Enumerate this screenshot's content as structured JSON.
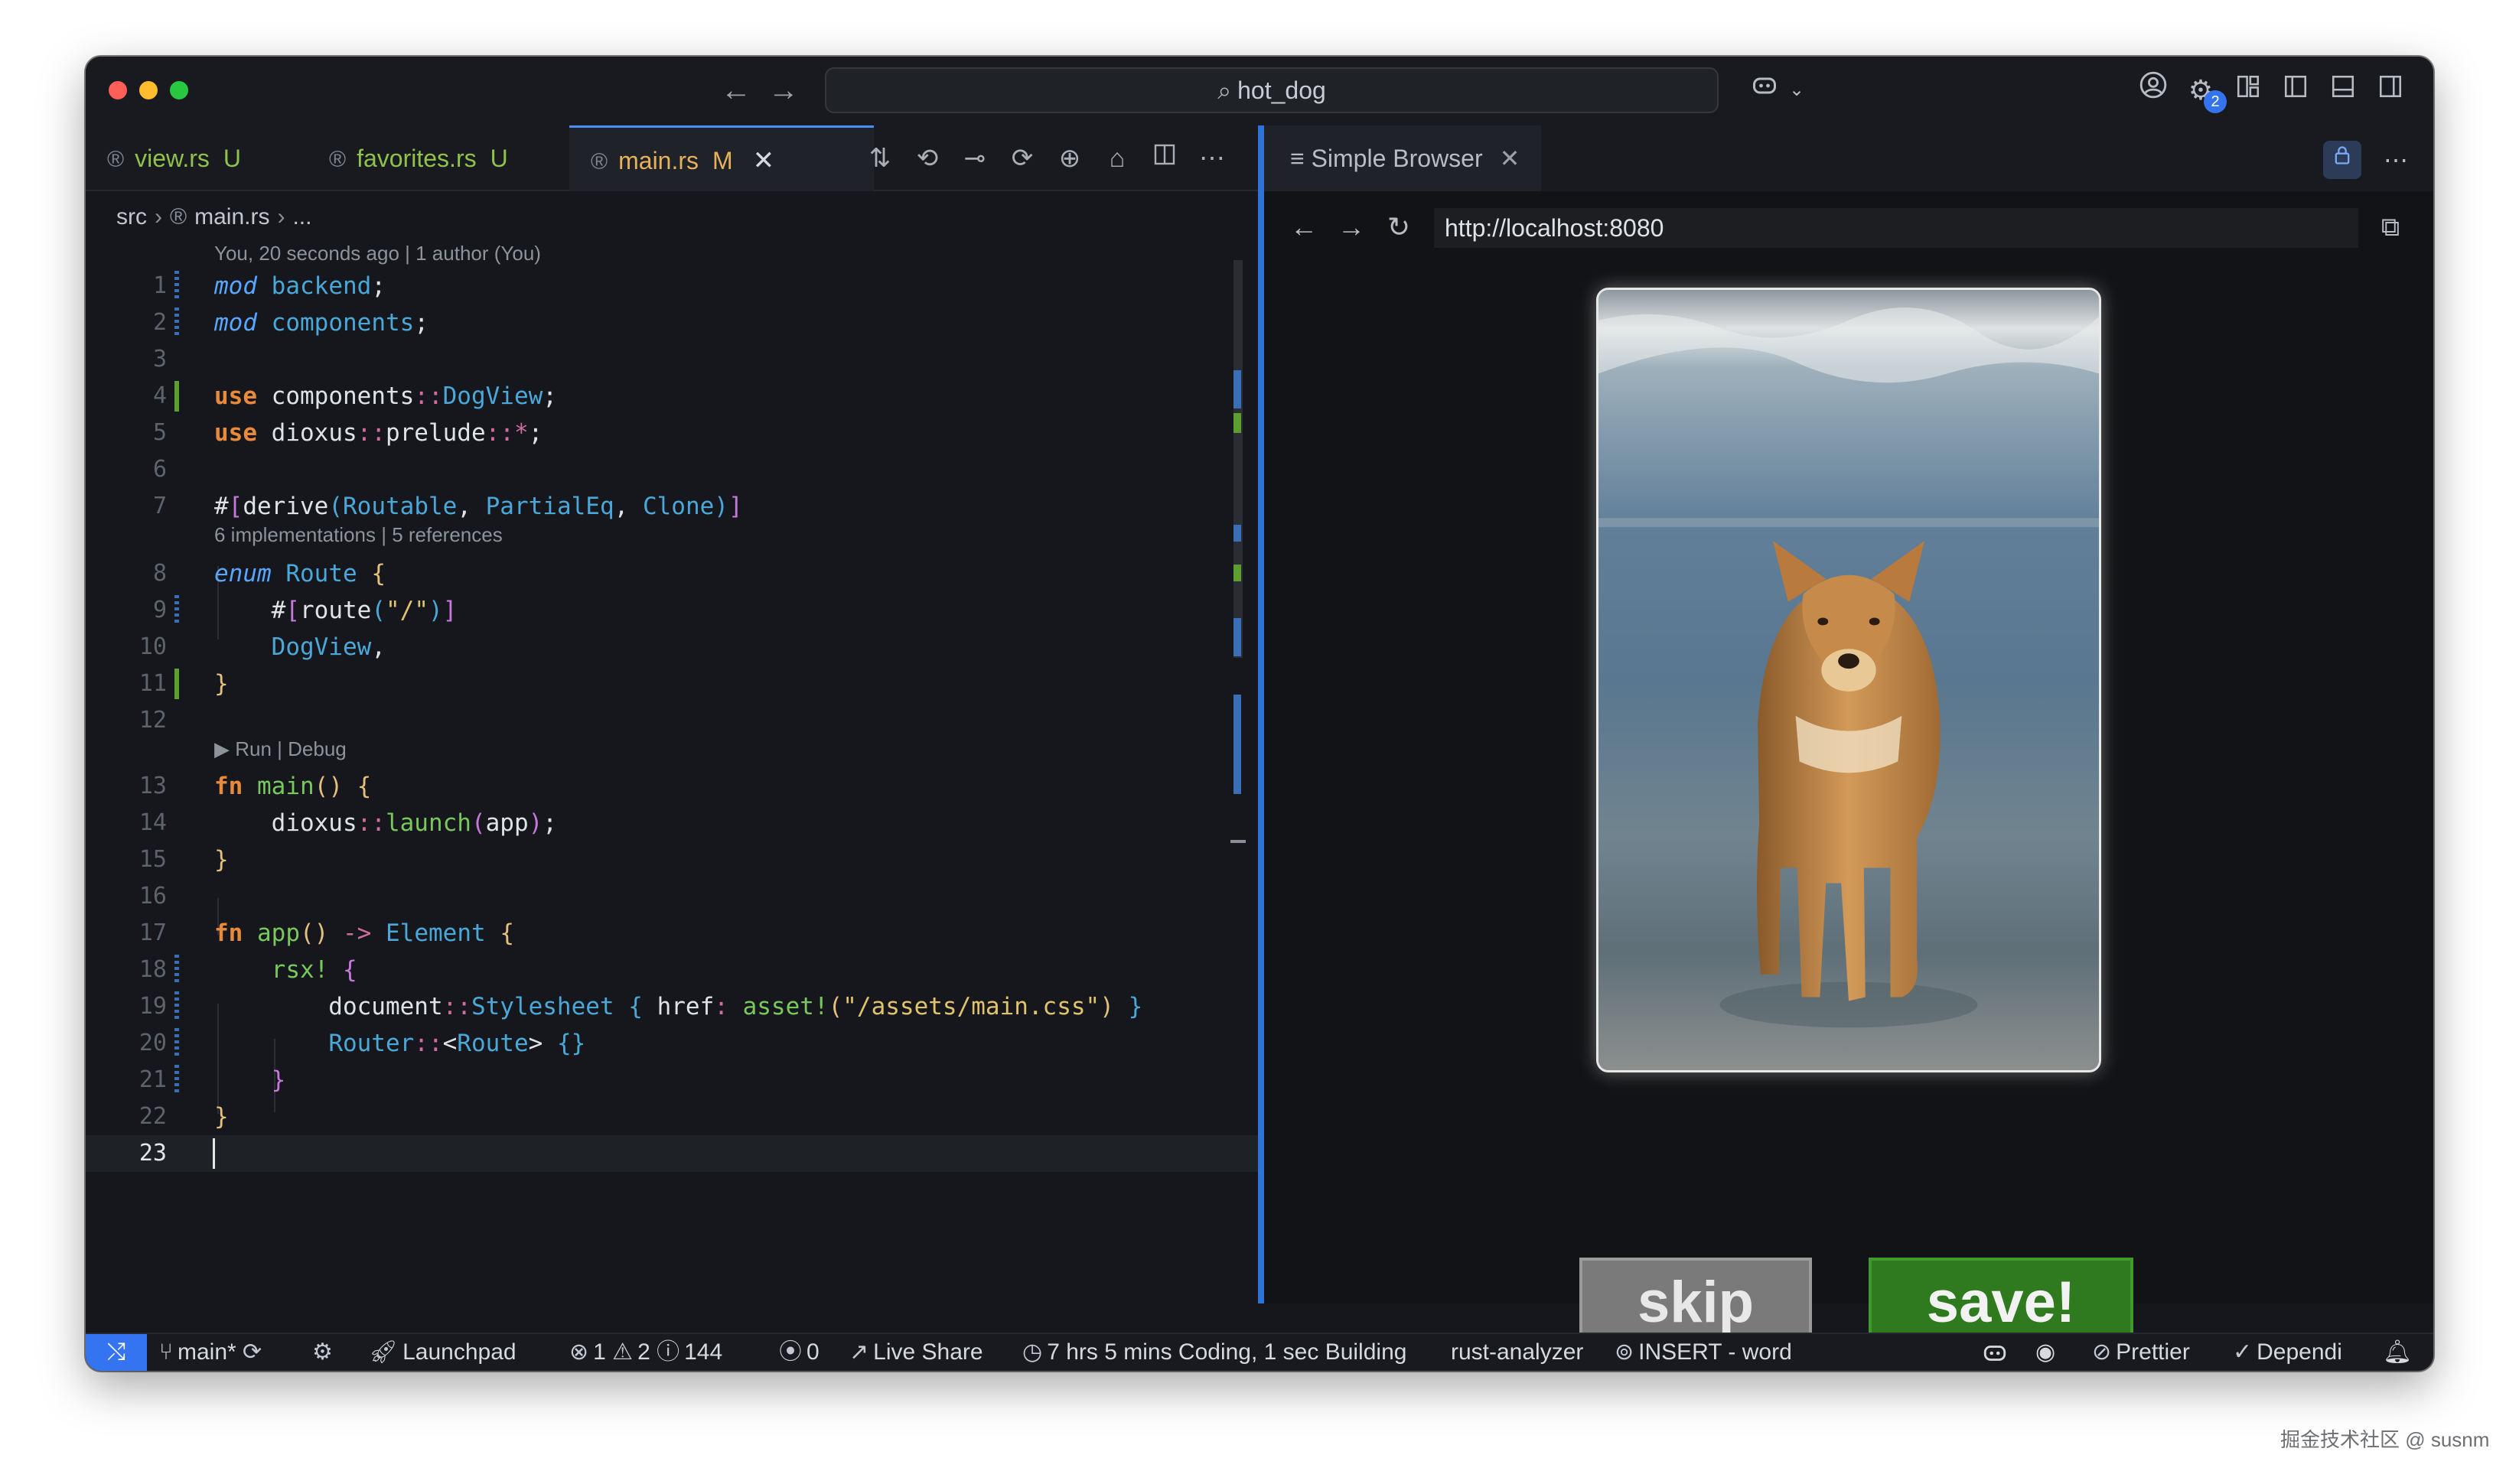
{
  "window": {
    "command_center": "hot_dog",
    "search_glyph": "⌕"
  },
  "editor": {
    "tabs": [
      {
        "label": "view.rs",
        "badge": "U"
      },
      {
        "label": "favorites.rs",
        "badge": "U"
      },
      {
        "label": "main.rs",
        "badge": "M"
      }
    ],
    "breadcrumb": {
      "folder": "src",
      "file": "main.rs",
      "more": "..."
    },
    "blame": "You, 20 seconds ago | 1 author (You)",
    "enum_lens": "6 implementations | 5 references",
    "run_lens": "▶ Run | Debug",
    "line_numbers": [
      "1",
      "2",
      "3",
      "4",
      "5",
      "6",
      "7",
      "8",
      "9",
      "10",
      "11",
      "12",
      "13",
      "14",
      "15",
      "16",
      "17",
      "18",
      "19",
      "20",
      "21",
      "22",
      "23"
    ]
  },
  "browser": {
    "tab_label": "Simple Browser",
    "url": "http://localhost:8080",
    "skip_label": "skip",
    "save_label": "save!"
  },
  "statusbar": {
    "branch": "main*",
    "launchpad": "Launchpad",
    "errors": "1",
    "warnings": "2",
    "infos": "144",
    "ports": "0",
    "live_share": "Live Share",
    "wakatime": "7 hrs 5 mins Coding, 1 sec Building",
    "analyzer": "rust-analyzer",
    "vim_mode": "INSERT - word",
    "prettier": "Prettier",
    "dependi": "Dependi"
  },
  "watermark": "掘金技术社区 @ susnm",
  "colors": {
    "accent": "#3574f0",
    "added": "#5c9e2f",
    "modified_tab": "#e6b15a",
    "untracked_tab": "#8fc24a",
    "save_button": "#2f7a1f",
    "skip_button": "#7a7a7a"
  }
}
